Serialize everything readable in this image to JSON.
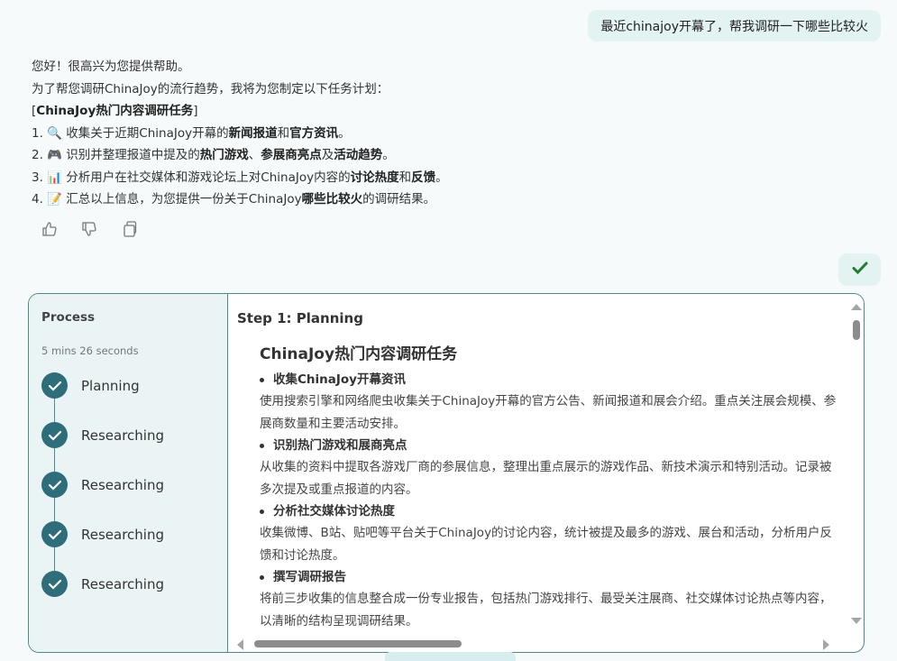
{
  "user_message": "最近chinajoy开幕了，帮我调研一下哪些比较火",
  "reply": {
    "greeting": "您好！很高兴为您提供帮助。",
    "intro": "为了帮您调研ChinaJoy的流行趋势，我将为您制定以下任务计划：",
    "plan_title_open": "[",
    "plan_title": "ChinaJoy热门内容调研任务",
    "plan_title_close": "]",
    "items": [
      {
        "num": "1.",
        "icon": "🔍",
        "pre": " 收集关于近期ChinaJoy开幕的",
        "b1": "新闻报道",
        "mid": "和",
        "b2": "官方资讯",
        "mid2": "",
        "b3": "",
        "post": "。"
      },
      {
        "num": "2.",
        "icon": "🎮",
        "pre": " 识别并整理报道中提及的",
        "b1": "热门游戏",
        "mid": "、",
        "b2": "参展商亮点",
        "mid2": "及",
        "b3": "活动趋势",
        "post": "。"
      },
      {
        "num": "3.",
        "icon": "📊",
        "pre": " 分析用户在社交媒体和游戏论坛上对ChinaJoy内容的",
        "b1": "讨论热度",
        "mid": "和",
        "b2": "反馈",
        "mid2": "",
        "b3": "",
        "post": "。"
      },
      {
        "num": "4.",
        "icon": "📝",
        "pre": " 汇总以上信息，为您提供一份关于ChinaJoy",
        "b1": "哪些比较火",
        "mid": "",
        "b2": "",
        "mid2": "",
        "b3": "",
        "post": "的调研结果。"
      }
    ]
  },
  "actions": {
    "like": "thumbs-up-icon",
    "dislike": "thumbs-down-icon",
    "copy": "copy-icon"
  },
  "confirm_icon": "checkmark-icon",
  "process": {
    "title": "Process",
    "elapsed": "5 mins 26 seconds",
    "steps": [
      {
        "label": "Planning"
      },
      {
        "label": "Researching"
      },
      {
        "label": "Researching"
      },
      {
        "label": "Researching"
      },
      {
        "label": "Researching"
      }
    ]
  },
  "content": {
    "step_heading": "Step 1: Planning",
    "doc_title": "ChinaJoy热门内容调研任务",
    "tasks": [
      {
        "title": "收集ChinaJoy开幕资讯",
        "desc": "使用搜索引擎和网络爬虫收集关于ChinaJoy开幕的官方公告、新闻报道和展会介绍。重点关注展会规模、参展商数量和主要活动安排。"
      },
      {
        "title": "识别热门游戏和展商亮点",
        "desc": "从收集的资料中提取各游戏厂商的参展信息，整理出重点展示的游戏作品、新技术演示和特别活动。记录被多次提及或重点报道的内容。"
      },
      {
        "title": "分析社交媒体讨论热度",
        "desc": "收集微博、B站、贴吧等平台关于ChinaJoy的讨论内容，统计被提及最多的游戏、展台和活动，分析用户反馈和讨论热度。"
      },
      {
        "title": "撰写调研报告",
        "desc": "将前三步收集的信息整合成一份专业报告，包括热门游戏排行、最受关注展商、社交媒体讨论热点等内容，以清晰的结构呈现调研结果。"
      }
    ]
  },
  "colors": {
    "accent": "#2e6d7a",
    "bubble": "#e2f3f2",
    "panel_border": "#4a8a93",
    "check": "#1e7d2e"
  }
}
